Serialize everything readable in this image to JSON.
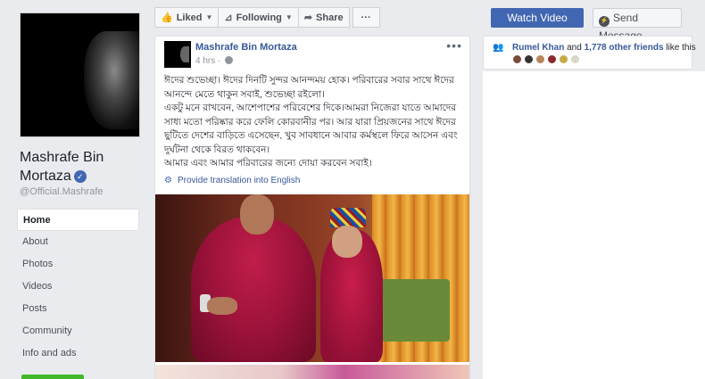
{
  "page": {
    "name": "Mashrafe Bin Mortaza",
    "handle": "@Official.Mashrafe",
    "verified_icon": "check-icon"
  },
  "actions": {
    "liked": "Liked",
    "following": "Following",
    "share": "Share",
    "more": "···",
    "watch_video": "Watch Video",
    "send_message": "Send Message"
  },
  "nav": {
    "items": [
      "Home",
      "About",
      "Photos",
      "Videos",
      "Posts",
      "Community",
      "Info and ads"
    ],
    "active": "Home"
  },
  "post": {
    "author": "Mashrafe Bin Mortaza",
    "time": "4 hrs",
    "options": "•••",
    "paragraphs": [
      "ঈদের শুভেচ্ছা। ঈদের দিনটি সুন্দর আনন্দময় হোক। পরিবারের সবার সাথে ঈদের আনন্দে মেতে থাকুন সবাই, শুভেচ্ছা রইলো।",
      "একটু মনে রাখবেন, আশেপাশের পরিবেশের দিকে।আমরা নিজেরা যাতে আমাদের সাধ্য মতো পরিষ্কার করে ফেলি কোরবানীর পর। আর যারা প্রিয়জনের সাথে ঈদের ছুটিতে দেশের বাড়িতে এসেছেন, খুব সাবধানে আবার কর্মস্থলে ফিরে আসেন এবং দুর্ঘটনা থেকে বিরত থাকবেন।",
      "আমার এবং আমার পরিবারের জন্যে দোয়া করবেন সবাই।"
    ],
    "translate": "Provide translation into English"
  },
  "friends": {
    "name": "Rumel Khan",
    "connector": " and ",
    "count": "1,778 other friends",
    "suffix": " like this",
    "avatar_colors": [
      "#7a4a3a",
      "#333333",
      "#b8865a",
      "#8a2a2a",
      "#c8a848",
      "#d8d8c8"
    ]
  },
  "colors": {
    "brand": "#4267b2",
    "link": "#365899",
    "background": "#e9ebee"
  }
}
